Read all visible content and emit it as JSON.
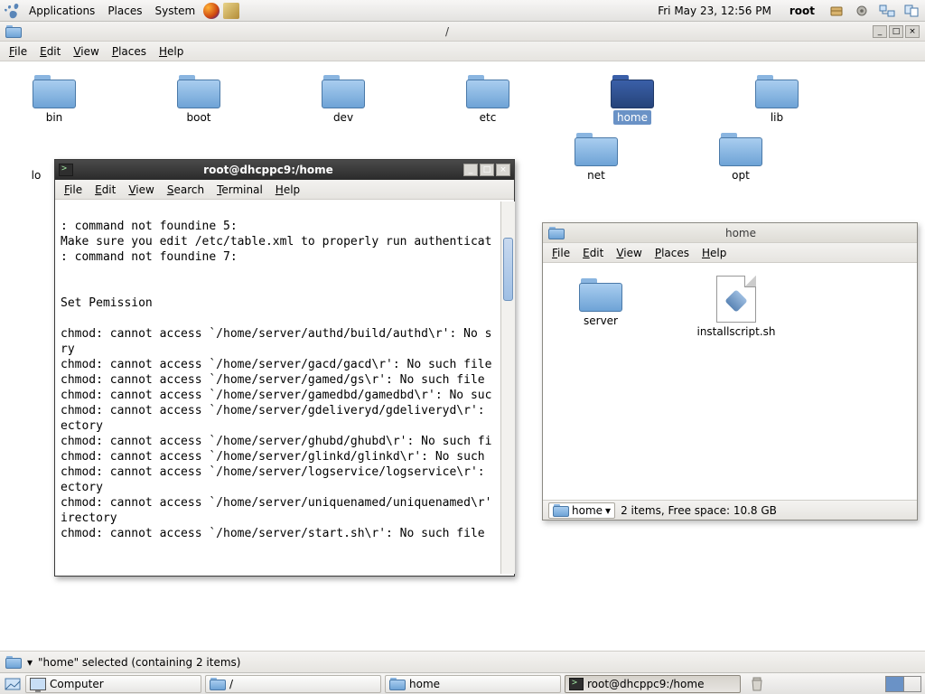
{
  "panel": {
    "apps": "Applications",
    "places": "Places",
    "system": "System",
    "clock": "Fri May 23, 12:56 PM",
    "user": "root"
  },
  "nautilus_root": {
    "title": "/",
    "menu": {
      "file": "File",
      "edit": "Edit",
      "view": "View",
      "places": "Places",
      "help": "Help"
    },
    "folders_row1": [
      "bin",
      "boot",
      "dev",
      "etc",
      "home",
      "lib"
    ],
    "folders_row2_partial": [
      "lo",
      "net",
      "opt"
    ],
    "selected": "home",
    "selection_msg": "\"home\" selected (containing 2 items)"
  },
  "terminal": {
    "title": "root@dhcppc9:/home",
    "menu": {
      "file": "File",
      "edit": "Edit",
      "view": "View",
      "search": "Search",
      "terminal": "Terminal",
      "help": "Help"
    },
    "content": "\n: command not foundine 5:\nMake sure you edit /etc/table.xml to properly run authenticat\n: command not foundine 7:\n\n\nSet Pemission\n\nchmod: cannot access `/home/server/authd/build/authd\\r': No s\nry\nchmod: cannot access `/home/server/gacd/gacd\\r': No such file\nchmod: cannot access `/home/server/gamed/gs\\r': No such file \nchmod: cannot access `/home/server/gamedbd/gamedbd\\r': No suc\nchmod: cannot access `/home/server/gdeliveryd/gdeliveryd\\r': \nectory\nchmod: cannot access `/home/server/ghubd/ghubd\\r': No such fi\nchmod: cannot access `/home/server/glinkd/glinkd\\r': No such \nchmod: cannot access `/home/server/logservice/logservice\\r': \nectory\nchmod: cannot access `/home/server/uniquenamed/uniquenamed\\r'\nirectory\nchmod: cannot access `/home/server/start.sh\\r': No such file "
  },
  "nautilus_home": {
    "title": "home",
    "menu": {
      "file": "File",
      "edit": "Edit",
      "view": "View",
      "places": "Places",
      "help": "Help"
    },
    "items": [
      {
        "name": "server",
        "type": "folder"
      },
      {
        "name": "installscript.sh",
        "type": "script"
      }
    ],
    "loc_label": "home",
    "status": "2 items, Free space: 10.8 GB"
  },
  "taskbar": {
    "computer": "Computer",
    "root": "/",
    "home": "home",
    "term": "root@dhcppc9:/home"
  }
}
